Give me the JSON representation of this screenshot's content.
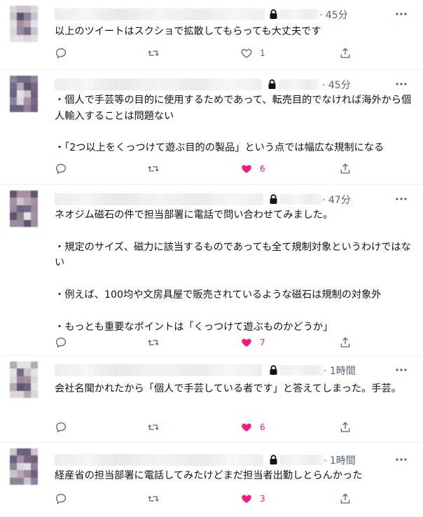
{
  "colors": {
    "like_active": "#f91880",
    "icon": "#536471",
    "text": "#0f1419",
    "border": "#eff3f4"
  },
  "icons": {
    "reply": "reply-icon",
    "retweet": "retweet-icon",
    "like": "heart-icon",
    "share": "share-icon",
    "lock": "lock-icon",
    "more": "more-icon"
  },
  "tweets": [
    {
      "time": "· 45分",
      "text": "以上のツイートはスクショで拡散してもらっても大丈夫です",
      "likes": "1",
      "liked": false
    },
    {
      "time": "· 45分",
      "text": "・個人で手芸等の目的に使用するためであって、転売目的でなければ海外から個人輸入することは問題ない\n\n・「2つ以上をくっつけて遊ぶ目的の製品」という点では幅広な規制になる",
      "likes": "6",
      "liked": true
    },
    {
      "time": "· 47分",
      "text": "ネオジム磁石の件で担当部署に電話で問い合わせてみました。\n\n・規定のサイズ、磁力に該当するものであっても全て規制対象というわけではない\n\n・例えば、100均や文房具屋で販売されているような磁石は規制の対象外\n\n・もっとも重要なポイントは「くっつけて遊ぶものかどうか」",
      "likes": "7",
      "liked": true
    },
    {
      "time": "· 1時間",
      "text": "会社名聞かれたから「個人で手芸している者です」と答えてしまった。手芸。",
      "likes": "6",
      "liked": true
    },
    {
      "time": "· 1時間",
      "text": "経産省の担当部署に電話してみたけどまだ担当者出勤しとらんかった",
      "likes": "3",
      "liked": true
    }
  ]
}
